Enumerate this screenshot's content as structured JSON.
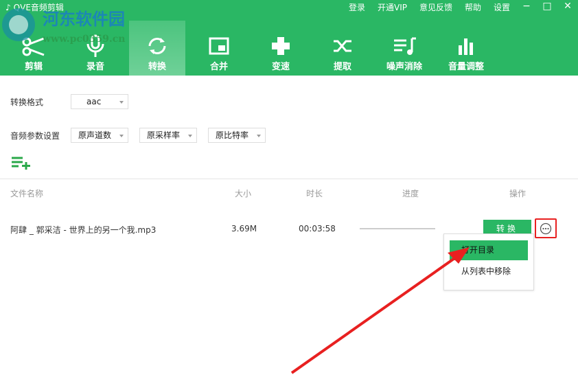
{
  "app": {
    "title": "QVE音频剪辑"
  },
  "topmenu": [
    "登录",
    "开通VIP",
    "意见反馈",
    "帮助",
    "设置"
  ],
  "watermark": {
    "name": "河东软件园",
    "url": "www.pc0359.cn"
  },
  "tabs": [
    {
      "label": "剪辑",
      "icon": "scissors-icon"
    },
    {
      "label": "录音",
      "icon": "microphone-icon"
    },
    {
      "label": "转换",
      "icon": "convert-icon",
      "active": true
    },
    {
      "label": "合并",
      "icon": "merge-icon"
    },
    {
      "label": "变速",
      "icon": "speed-icon"
    },
    {
      "label": "提取",
      "icon": "shuffle-icon"
    },
    {
      "label": "噪声消除",
      "icon": "noise-icon"
    },
    {
      "label": "音量调整",
      "icon": "volume-bars-icon"
    }
  ],
  "settings": {
    "format_label": "转换格式",
    "format_value": "aac",
    "audio_label": "音频参数设置",
    "channels": "原声道数",
    "sample_rate": "原采样率",
    "bitrate": "原比特率"
  },
  "table": {
    "headers": [
      "文件名称",
      "大小",
      "时长",
      "进度",
      "操作"
    ],
    "rows": [
      {
        "name": "阿肆 _ 郭采洁 - 世界上的另一个我.mp3",
        "size": "3.69M",
        "duration": "00:03:58",
        "progress": 0,
        "action": "转换"
      }
    ]
  },
  "context_menu": [
    "打开目录",
    "从列表中移除"
  ],
  "colors": {
    "brand": "#2ab764",
    "highlight": "#e82020"
  }
}
